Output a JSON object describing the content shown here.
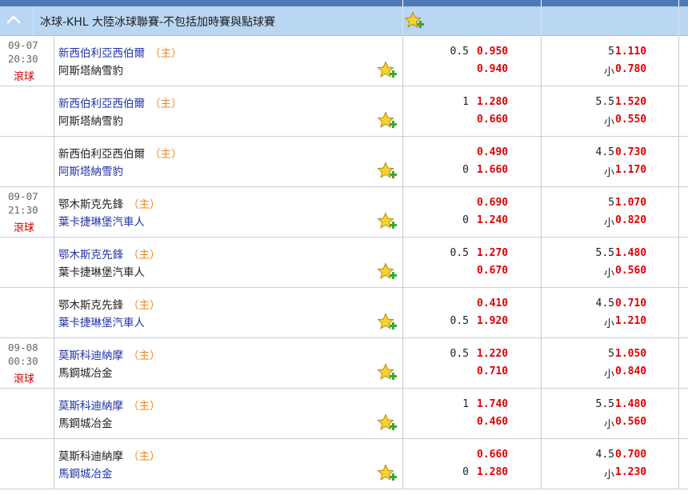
{
  "league": {
    "title": "冰球-KHL 大陸冰球聯賽-不包括加時賽與點球賽"
  },
  "rows": [
    {
      "date": "09-07",
      "time": "20:30",
      "live": "滾球",
      "team1": "新西伯利亞西伯爾",
      "team1_home": "（主）",
      "team2": "阿斯塔納雪豹",
      "hdp1": "0.5",
      "hdp_odds1": "0.950",
      "hdp2": "",
      "hdp_odds2": "0.940",
      "ou1": "5",
      "ou_odds1": "1.110",
      "ou2": "小",
      "ou_odds2": "0.780"
    },
    {
      "date": "",
      "time": "",
      "live": "",
      "team1": "新西伯利亞西伯爾",
      "team1_home": "（主）",
      "team2": "阿斯塔納雪豹",
      "hdp1": "1",
      "hdp_odds1": "1.280",
      "hdp2": "",
      "hdp_odds2": "0.660",
      "ou1": "5.5",
      "ou_odds1": "1.520",
      "ou2": "小",
      "ou_odds2": "0.550"
    },
    {
      "date": "",
      "time": "",
      "live": "",
      "team1": "新西伯利亞西伯爾",
      "team1_home": "（主）",
      "team2": "阿斯塔納雪豹",
      "hdp1": "",
      "hdp_odds1": "0.490",
      "hdp2": "0",
      "hdp_odds2": "1.660",
      "ou1": "4.5",
      "ou_odds1": "0.730",
      "ou2": "小",
      "ou_odds2": "1.170"
    },
    {
      "date": "09-07",
      "time": "21:30",
      "live": "滾球",
      "team1": "鄂木斯克先鋒",
      "team1_home": "（主）",
      "team2": "葉卡捷琳堡汽車人",
      "hdp1": "",
      "hdp_odds1": "0.690",
      "hdp2": "0",
      "hdp_odds2": "1.240",
      "ou1": "5",
      "ou_odds1": "1.070",
      "ou2": "小",
      "ou_odds2": "0.820"
    },
    {
      "date": "",
      "time": "",
      "live": "",
      "team1": "鄂木斯克先鋒",
      "team1_home": "（主）",
      "team2": "葉卡捷琳堡汽車人",
      "hdp1": "0.5",
      "hdp_odds1": "1.270",
      "hdp2": "",
      "hdp_odds2": "0.670",
      "ou1": "5.5",
      "ou_odds1": "1.480",
      "ou2": "小",
      "ou_odds2": "0.560"
    },
    {
      "date": "",
      "time": "",
      "live": "",
      "team1": "鄂木斯克先鋒",
      "team1_home": "（主）",
      "team2": "葉卡捷琳堡汽車人",
      "hdp1": "",
      "hdp_odds1": "0.410",
      "hdp2": "0.5",
      "hdp_odds2": "1.920",
      "ou1": "4.5",
      "ou_odds1": "0.710",
      "ou2": "小",
      "ou_odds2": "1.210"
    },
    {
      "date": "09-08",
      "time": "00:30",
      "live": "滾球",
      "team1": "莫斯科迪納摩",
      "team1_home": "（主）",
      "team2": "馬鋼城冶金",
      "hdp1": "0.5",
      "hdp_odds1": "1.220",
      "hdp2": "",
      "hdp_odds2": "0.710",
      "ou1": "5",
      "ou_odds1": "1.050",
      "ou2": "小",
      "ou_odds2": "0.840"
    },
    {
      "date": "",
      "time": "",
      "live": "",
      "team1": "莫斯科迪納摩",
      "team1_home": "（主）",
      "team2": "馬鋼城冶金",
      "hdp1": "1",
      "hdp_odds1": "1.740",
      "hdp2": "",
      "hdp_odds2": "0.460",
      "ou1": "5.5",
      "ou_odds1": "1.480",
      "ou2": "小",
      "ou_odds2": "0.560"
    },
    {
      "date": "",
      "time": "",
      "live": "",
      "team1": "莫斯科迪納摩",
      "team1_home": "（主）",
      "team2": "馬鋼城冶金",
      "hdp1": "",
      "hdp_odds1": "0.660",
      "hdp2": "0",
      "hdp_odds2": "1.280",
      "ou1": "4.5",
      "ou_odds1": "0.700",
      "ou2": "小",
      "ou_odds2": "1.230"
    }
  ],
  "icons": {
    "collapse": "chevron-up-icon",
    "favorite": "star-plus-icon"
  },
  "colors": {
    "header": "#b9d6f2",
    "topbar": "#4d7ab6",
    "favorite_team": "#2233aa",
    "home_tag": "#f0861a",
    "odds": "#e00000",
    "live": "#cc0000"
  }
}
